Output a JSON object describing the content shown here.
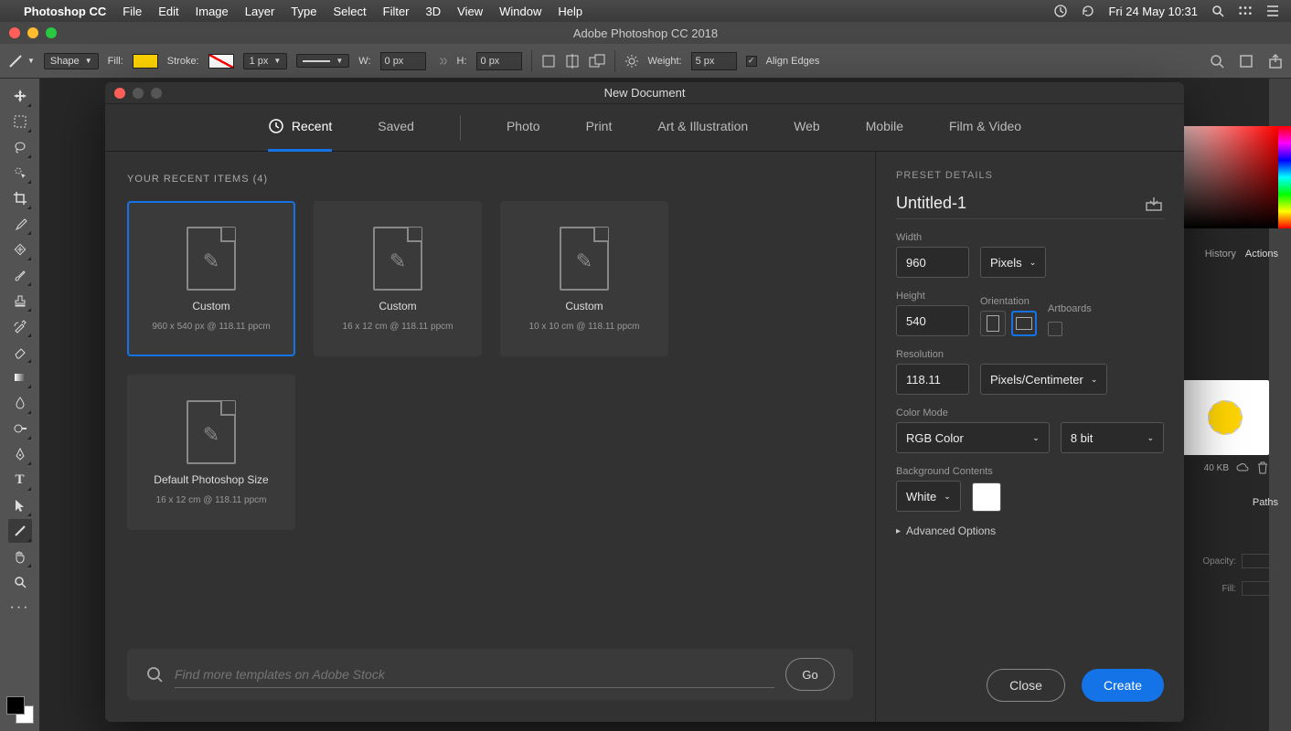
{
  "macos": {
    "app_name": "Photoshop CC",
    "menus": [
      "File",
      "Edit",
      "Image",
      "Layer",
      "Type",
      "Select",
      "Filter",
      "3D",
      "View",
      "Window",
      "Help"
    ],
    "datetime": "Fri 24 May  10:31"
  },
  "window": {
    "title": "Adobe Photoshop CC 2018"
  },
  "options_bar": {
    "mode": "Shape",
    "fill_label": "Fill:",
    "stroke_label": "Stroke:",
    "stroke_width": "1 px",
    "w_label": "W:",
    "w_value": "0 px",
    "h_label": "H:",
    "h_value": "0 px",
    "weight_label": "Weight:",
    "weight_value": "5 px",
    "align_edges": "Align Edges"
  },
  "dialog": {
    "title": "New Document",
    "tabs": [
      "Recent",
      "Saved",
      "Photo",
      "Print",
      "Art & Illustration",
      "Web",
      "Mobile",
      "Film & Video"
    ],
    "active_tab": "Recent",
    "recent_header": "YOUR RECENT ITEMS  (4)",
    "presets": [
      {
        "name": "Custom",
        "dims": "960 x 540 px @ 118.11 ppcm",
        "selected": true
      },
      {
        "name": "Custom",
        "dims": "16 x 12 cm @ 118.11 ppcm",
        "selected": false
      },
      {
        "name": "Custom",
        "dims": "10 x 10 cm @ 118.11 ppcm",
        "selected": false
      },
      {
        "name": "Default Photoshop Size",
        "dims": "16 x 12 cm @ 118.11 ppcm",
        "selected": false
      }
    ],
    "search_placeholder": "Find more templates on Adobe Stock",
    "go_label": "Go",
    "close_label": "Close",
    "create_label": "Create"
  },
  "preset_details": {
    "header": "PRESET DETAILS",
    "doc_name": "Untitled-1",
    "width_label": "Width",
    "width_value": "960",
    "width_unit": "Pixels",
    "height_label": "Height",
    "height_value": "540",
    "orientation_label": "Orientation",
    "artboards_label": "Artboards",
    "resolution_label": "Resolution",
    "resolution_value": "118.11",
    "resolution_unit": "Pixels/Centimeter",
    "color_mode_label": "Color Mode",
    "color_mode": "RGB Color",
    "bit_depth": "8 bit",
    "bg_label": "Background Contents",
    "bg_value": "White",
    "advanced": "Advanced Options"
  },
  "side_panels": {
    "history_tab": "History",
    "actions_tab": "Actions",
    "lib_size": "40 KB",
    "paths_tab": "Paths",
    "opacity_label": "Opacity:",
    "fill_label": "Fill:"
  }
}
